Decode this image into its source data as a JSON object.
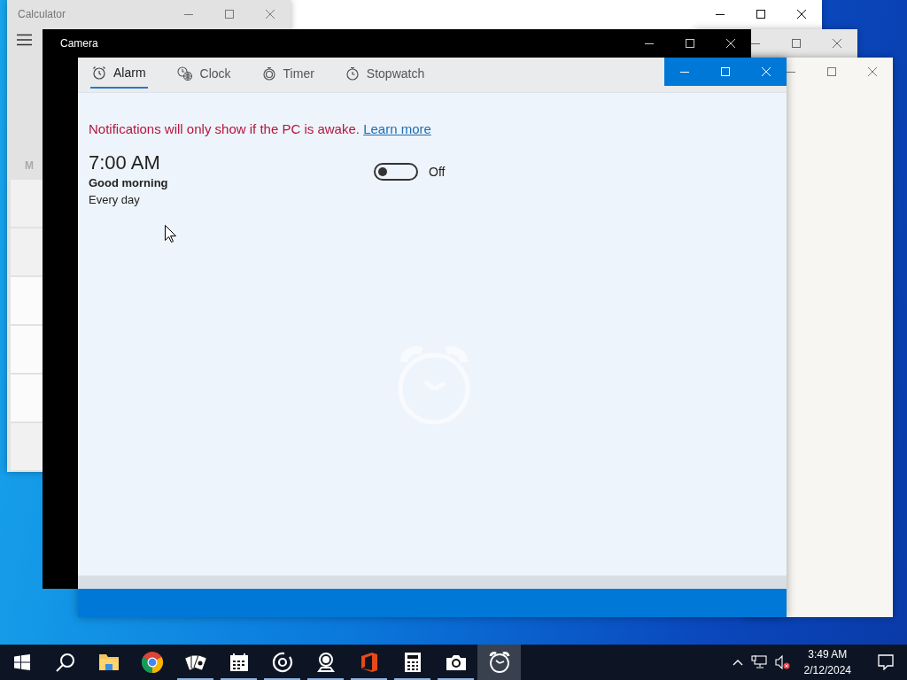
{
  "calculator_window": {
    "title": "Calculator",
    "memory_label": "M"
  },
  "camera_window": {
    "title": "Camera"
  },
  "alarms_window": {
    "tabs": [
      {
        "kind": "alarm",
        "label": "Alarm",
        "selected": true
      },
      {
        "kind": "clock",
        "label": "Clock",
        "selected": false
      },
      {
        "kind": "timer",
        "label": "Timer",
        "selected": false
      },
      {
        "kind": "stopwatch",
        "label": "Stopwatch",
        "selected": false
      }
    ],
    "notice": "Notifications will only show if the PC is awake.",
    "notice_link": "Learn more",
    "alarms": [
      {
        "time": "7:00 AM",
        "name": "Good morning",
        "repeat": "Every day",
        "on": false,
        "state_label": "Off"
      }
    ]
  },
  "taskbar": {
    "apps": [
      {
        "kind": "explorer",
        "running": false,
        "active": false
      },
      {
        "kind": "browser",
        "running": false,
        "active": false
      },
      {
        "kind": "cards",
        "running": true,
        "active": false
      },
      {
        "kind": "calendar",
        "running": true,
        "active": false
      },
      {
        "kind": "music",
        "running": true,
        "active": false
      },
      {
        "kind": "maps",
        "running": true,
        "active": false
      },
      {
        "kind": "office",
        "running": true,
        "active": false
      },
      {
        "kind": "calculator",
        "running": true,
        "active": false
      },
      {
        "kind": "camera",
        "running": true,
        "active": false
      },
      {
        "kind": "alarms",
        "running": false,
        "active": true
      }
    ],
    "volume_muted": true,
    "time": "3:49 AM",
    "date": "2/12/2024"
  }
}
